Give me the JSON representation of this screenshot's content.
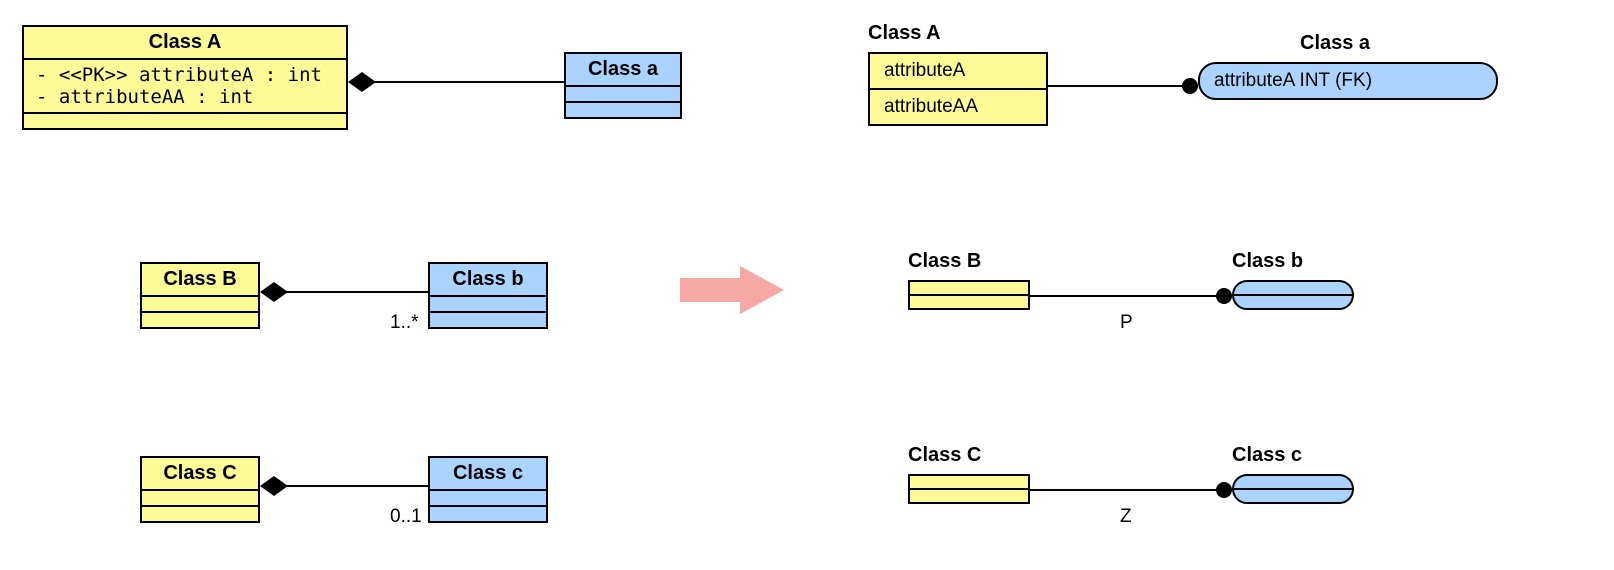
{
  "left": {
    "row1": {
      "classA": {
        "name": "Class A",
        "attr1": "- <<PK>> attributeA : int",
        "attr2": "- attributeAA : int"
      },
      "classa": {
        "name": "Class a"
      }
    },
    "row2": {
      "classB": {
        "name": "Class B"
      },
      "classb": {
        "name": "Class b",
        "mult": "1..*"
      }
    },
    "row3": {
      "classC": {
        "name": "Class C"
      },
      "classc": {
        "name": "Class c",
        "mult": "0..1"
      }
    }
  },
  "right": {
    "row1": {
      "classA": {
        "name": "Class A",
        "attr1": "attributeA",
        "attr2": "attributeAA"
      },
      "classa": {
        "name": "Class a",
        "attr1": "attributeA INT  (FK)"
      }
    },
    "row2": {
      "classB": {
        "name": "Class B"
      },
      "classb": {
        "name": "Class b",
        "mark": "P"
      }
    },
    "row3": {
      "classC": {
        "name": "Class C"
      },
      "classc": {
        "name": "Class c",
        "mark": "Z"
      }
    }
  },
  "chart_data": {
    "type": "table",
    "description": "UML class-diagram composition mapping to IE/Crow's-foot relational notation",
    "mappings": [
      {
        "uml": {
          "owner": {
            "name": "Class A",
            "attributes": [
              {
                "name": "attributeA",
                "type": "int",
                "stereotype": "PK",
                "visibility": "-"
              },
              {
                "name": "attributeAA",
                "type": "int",
                "visibility": "-"
              }
            ]
          },
          "part": {
            "name": "Class a"
          },
          "relation": "composition",
          "diamond_at": "Class A",
          "multiplicity_part": null
        },
        "ie": {
          "owner": {
            "name": "Class A",
            "columns": [
              "attributeA",
              "attributeAA"
            ]
          },
          "part": {
            "name": "Class a",
            "columns": [
              "attributeA INT (FK)"
            ],
            "independent": false
          },
          "endpoint_part": "mandatory-one",
          "participation_mark": null
        }
      },
      {
        "uml": {
          "owner": {
            "name": "Class B"
          },
          "part": {
            "name": "Class b"
          },
          "relation": "composition",
          "diamond_at": "Class B",
          "multiplicity_part": "1..*"
        },
        "ie": {
          "owner": {
            "name": "Class B"
          },
          "part": {
            "name": "Class b",
            "independent": false
          },
          "endpoint_part": "mandatory-one",
          "participation_mark": "P"
        }
      },
      {
        "uml": {
          "owner": {
            "name": "Class C"
          },
          "part": {
            "name": "Class c"
          },
          "relation": "composition",
          "diamond_at": "Class C",
          "multiplicity_part": "0..1"
        },
        "ie": {
          "owner": {
            "name": "Class C"
          },
          "part": {
            "name": "Class c",
            "independent": false
          },
          "endpoint_part": "mandatory-one",
          "participation_mark": "Z"
        }
      }
    ]
  }
}
